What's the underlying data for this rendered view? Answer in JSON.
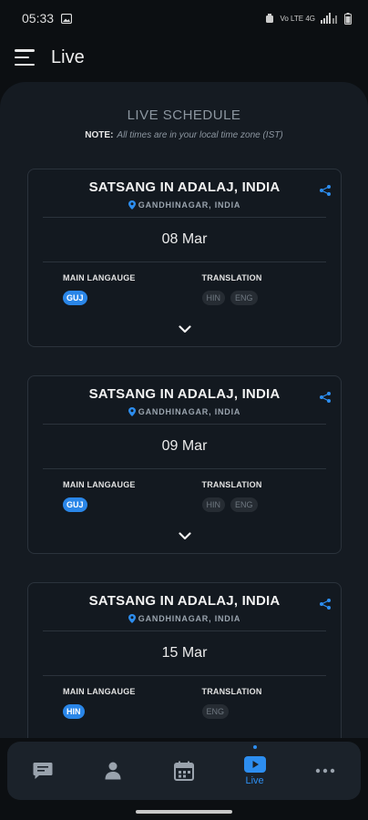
{
  "status_bar": {
    "time": "05:33",
    "network": "Vo LTE 4G"
  },
  "app_bar": {
    "title": "Live"
  },
  "schedule": {
    "heading": "LIVE SCHEDULE",
    "note_label": "NOTE:",
    "note_text": "All times are in your local time zone (IST)"
  },
  "labels": {
    "main_language": "MAIN LANGAUGE",
    "translation": "TRANSLATION"
  },
  "events": [
    {
      "title": "SATSANG IN ADALAJ, INDIA",
      "location": "GANDHINAGAR, INDIA",
      "date": "08 Mar",
      "main_language": "GUJ",
      "translations": [
        "HIN",
        "ENG"
      ]
    },
    {
      "title": "SATSANG IN ADALAJ, INDIA",
      "location": "GANDHINAGAR, INDIA",
      "date": "09 Mar",
      "main_language": "GUJ",
      "translations": [
        "HIN",
        "ENG"
      ]
    },
    {
      "title": "SATSANG IN ADALAJ, INDIA",
      "location": "GANDHINAGAR, INDIA",
      "date": "15 Mar",
      "main_language": "HIN",
      "translations": [
        "ENG"
      ]
    }
  ],
  "bottom_nav": {
    "active_label": "Live"
  },
  "colors": {
    "accent": "#2d8ef0",
    "chip_main": "#2a86e8",
    "background": "#0c0f12",
    "panel": "#151b22"
  }
}
